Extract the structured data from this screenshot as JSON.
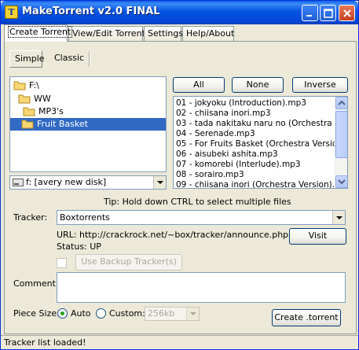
{
  "window": {
    "title": "MakeTorrent v2.0 FINAL",
    "icon_name": "maketorrent-app-icon"
  },
  "tabs": [
    {
      "label": "Create Torrent",
      "active": true
    },
    {
      "label": "View/Edit Torrent",
      "active": false
    },
    {
      "label": "Settings",
      "active": false
    },
    {
      "label": "Help/About",
      "active": false
    }
  ],
  "mode_tabs": [
    {
      "label": "Simple",
      "active": true
    },
    {
      "label": "Classic",
      "active": false
    }
  ],
  "folder_tree": [
    {
      "label": "F:\\",
      "level": 0,
      "selected": false,
      "icon": "folder-open-icon"
    },
    {
      "label": "WW",
      "level": 1,
      "selected": false,
      "icon": "folder-open-icon"
    },
    {
      "label": "MP3's",
      "level": 2,
      "selected": false,
      "icon": "folder-open-icon"
    },
    {
      "label": "Fruit Basket",
      "level": 3,
      "selected": true,
      "icon": "folder-open-icon"
    }
  ],
  "drive_select": {
    "value": "f: [avery new disk]"
  },
  "file_buttons": {
    "all": "All",
    "none": "None",
    "inverse": "Inverse"
  },
  "files": [
    "01 - jokyoku (Introduction).mp3",
    "02 - chiisana inori.mp3",
    "03 - tada nakitaku naru no (Orchestra Vers",
    "04 - Serenade.mp3",
    "05 - For Fruits Basket (Orchestra Version).m",
    "06 - aisubeki ashita.mp3",
    "07 - komorebi (Interlude).mp3",
    "08 - sorairo.mp3",
    "09 - chiisana inori (Orchestra Version).mp3"
  ],
  "tip": "Tip: Hold down CTRL to select multiple files",
  "tracker": {
    "label": "Tracker:",
    "value": "Boxtorrents",
    "url": "URL: http://crackrock.net/~box/tracker/announce.php",
    "status": "Status: UP",
    "visit_label": "Visit",
    "backup_label": "Use Backup Tracker(s)"
  },
  "comment": {
    "label": "Comment:",
    "value": ""
  },
  "piece_size": {
    "label": "Piece Size:",
    "auto_label": "Auto",
    "custom_label": "Custom:",
    "custom_value": "256kb",
    "selected": "Auto"
  },
  "create_button": "Create .torrent",
  "status_bar": "Tracker list loaded!"
}
